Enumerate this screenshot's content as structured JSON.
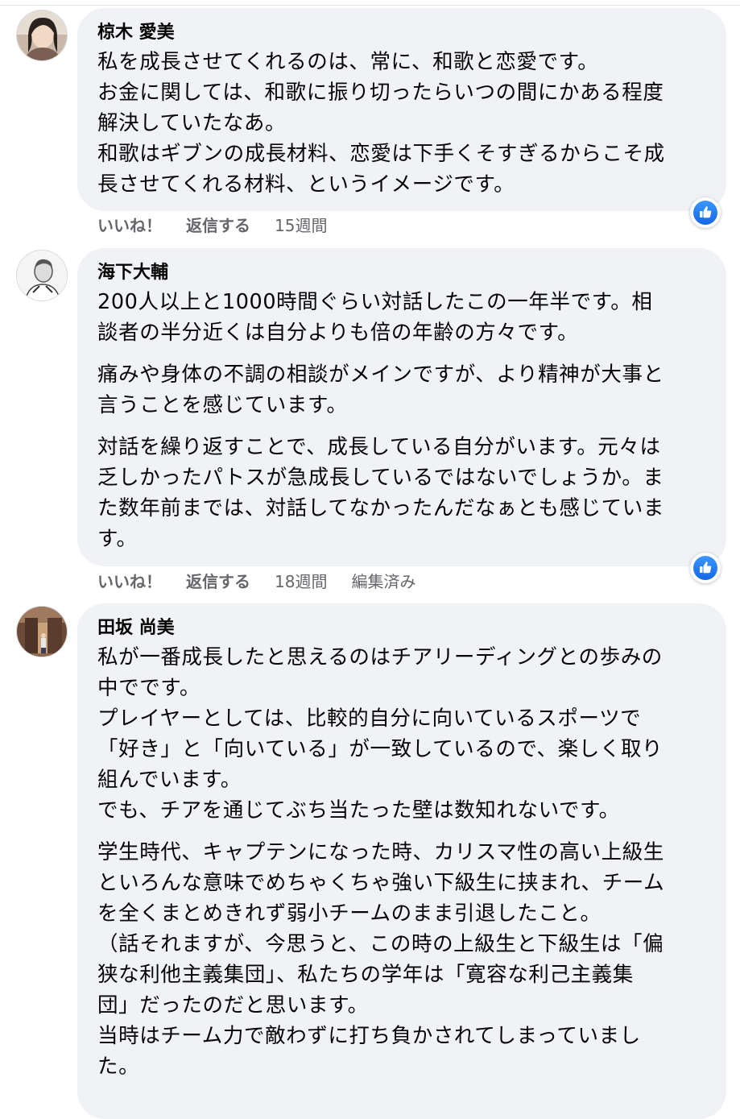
{
  "comments": [
    {
      "author": "椋木 愛美",
      "paragraphs": [
        [
          "私を成長させてくれるのは、常に、和歌と恋愛です。",
          "お金に関しては、和歌に振り切ったらいつの間にかある程度",
          "解決していたなあ。",
          "和歌はギブンの成長材料、恋愛は下手くそすぎるからこそ成",
          "長させてくれる材料、というイメージです。"
        ]
      ],
      "actions": {
        "like": "いいね！",
        "reply": "返信する",
        "time": "15週間",
        "edited": ""
      }
    },
    {
      "author": "海下大輔",
      "paragraphs": [
        [
          "200人以上と1000時間ぐらい対話したこの一年半です。相",
          "談者の半分近くは自分よりも倍の年齢の方々です。"
        ],
        [
          "痛みや身体の不調の相談がメインですが、より精神が大事と",
          "言うことを感じています。"
        ],
        [
          "対話を繰り返すことで、成長している自分がいます。元々は",
          "乏しかったパトスが急成長しているではないでしょうか。ま",
          "た数年前までは、対話してなかったんだなぁとも感じていま",
          "す。"
        ]
      ],
      "actions": {
        "like": "いいね！",
        "reply": "返信する",
        "time": "18週間",
        "edited": "編集済み"
      }
    },
    {
      "author": "田坂 尚美",
      "paragraphs": [
        [
          "私が一番成長したと思えるのはチアリーディングとの歩みの",
          "中でです。",
          "プレイヤーとしては、比較的自分に向いているスポーツで",
          "「好き」と「向いている」が一致しているので、楽しく取り",
          "組んでいます。",
          "でも、チアを通じてぶち当たった壁は数知れないです。"
        ],
        [
          "学生時代、キャプテンになった時、カリスマ性の高い上級生",
          "といろんな意味でめちゃくちゃ強い下級生に挟まれ、チーム",
          "を全くまとめきれず弱小チームのまま引退したこと。",
          "（話それますが、今思うと、この時の上級生と下級生は「偏",
          "狭な利他主義集団」、私たちの学年は「寛容な利己主義集",
          "団」だったのだと思います。",
          "当時はチーム力で敵わずに打ち負かされてしまっていまし",
          "た。"
        ]
      ],
      "actions": {
        "like": "",
        "reply": "",
        "time": "",
        "edited": ""
      }
    }
  ],
  "icons": {
    "reaction": "like-thumb-icon",
    "avatar": "user-avatar"
  },
  "colors": {
    "bubble": "#f0f2f5",
    "meta_text": "#65676b",
    "like_blue": "#1877f2"
  }
}
